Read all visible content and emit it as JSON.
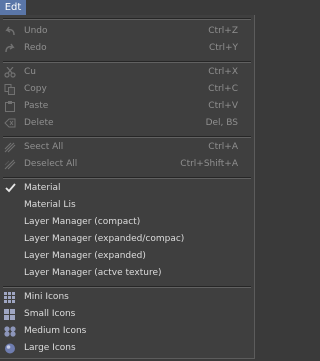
{
  "menubar": {
    "title": "Edt"
  },
  "items": [
    {
      "label": "Undo",
      "shortcut": "Ctrl+Z",
      "enabled": false,
      "icon": "undo-icon"
    },
    {
      "label": "Redo",
      "shortcut": "Ctrl+Y",
      "enabled": false,
      "icon": "redo-icon"
    },
    {
      "label": "Cu",
      "shortcut": "Ctrl+X",
      "enabled": false,
      "icon": "cut-icon"
    },
    {
      "label": "Copy",
      "shortcut": "Ctrl+C",
      "enabled": false,
      "icon": "copy-icon"
    },
    {
      "label": "Paste",
      "shortcut": "Ctrl+V",
      "enabled": false,
      "icon": "paste-icon"
    },
    {
      "label": "Delete",
      "shortcut": "Del, BS",
      "enabled": false,
      "icon": "delete-icon"
    },
    {
      "label": "Seect All",
      "shortcut": "Ctrl+A",
      "enabled": false,
      "icon": "select-all-icon"
    },
    {
      "label": "Deselect All",
      "shortcut": "Ctrl+Shift+A",
      "enabled": false,
      "icon": "deselect-all-icon"
    },
    {
      "label": "Material",
      "shortcut": "",
      "enabled": true,
      "checked": true,
      "icon": "checkmark-icon"
    },
    {
      "label": "Material Lis",
      "shortcut": "",
      "enabled": true
    },
    {
      "label": "Layer Manager (compact)",
      "shortcut": "",
      "enabled": true
    },
    {
      "label": "Layer Manager (expanded/compac)",
      "shortcut": "",
      "enabled": true
    },
    {
      "label": "Layer Manager (expanded)",
      "shortcut": "",
      "enabled": true
    },
    {
      "label": "Layer Manager (actve texture)",
      "shortcut": "",
      "enabled": true
    },
    {
      "label": "Mini Icons",
      "shortcut": "",
      "enabled": true,
      "icon": "mini-icons-icon"
    },
    {
      "label": "Small Icons",
      "shortcut": "",
      "enabled": true,
      "icon": "small-icons-icon"
    },
    {
      "label": "Medium Icons",
      "shortcut": "",
      "enabled": true,
      "icon": "medium-icons-icon"
    },
    {
      "label": "Large Icons",
      "shortcut": "",
      "enabled": true,
      "icon": "large-icons-icon"
    }
  ],
  "colors": {
    "menu_highlight": "#5a76a8",
    "panel_bg": "#3f3f3f",
    "text_enabled": "#dcdcdc",
    "text_disabled": "#8f8f8f"
  }
}
